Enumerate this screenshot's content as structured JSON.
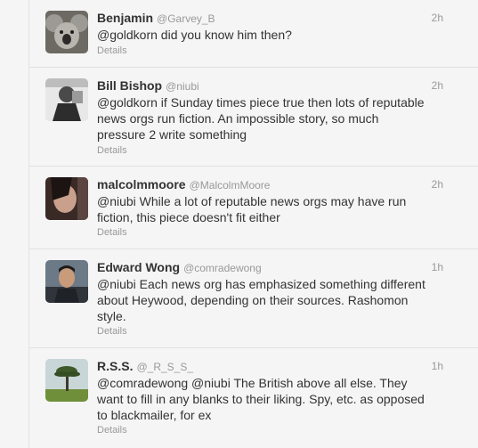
{
  "tweets": [
    {
      "name": "Benjamin",
      "handle": "@Garvey_B",
      "time": "2h",
      "text": "@goldkorn did you know him then?",
      "details": "Details",
      "avatar_icon": "koala-avatar"
    },
    {
      "name": "Bill Bishop",
      "handle": "@niubi",
      "time": "2h",
      "text_lines": [
        "@goldkorn if Sunday times piece true then lots of reputable",
        "news orgs run fiction. An impossible story, so much",
        "pressure 2 write something"
      ],
      "details": "Details",
      "avatar_icon": "bw-portrait-avatar"
    },
    {
      "name": "malcolmmoore",
      "handle": "@MalcolmMoore",
      "time": "2h",
      "text_lines": [
        "@niubi While a lot of reputable news orgs may have run",
        "fiction, this piece doesn't fit either"
      ],
      "details": "Details",
      "avatar_icon": "dark-portrait-avatar"
    },
    {
      "name": "Edward Wong",
      "handle": "@comradewong",
      "time": "1h",
      "text_lines": [
        "@niubi Each news org has emphasized something different",
        "about Heywood, depending on their sources. Rashomon",
        "style."
      ],
      "details": "Details",
      "avatar_icon": "man-portrait-avatar"
    },
    {
      "name": "R.S.S.",
      "handle": "@_R_S_S_",
      "time": "1h",
      "text_lines": [
        "@comradewong @niubi The British above all else. They",
        "want to fill in any blanks to their liking. Spy, etc. as opposed",
        "to blackmailer, for ex"
      ],
      "details": "Details",
      "avatar_icon": "palm-tree-avatar"
    }
  ]
}
